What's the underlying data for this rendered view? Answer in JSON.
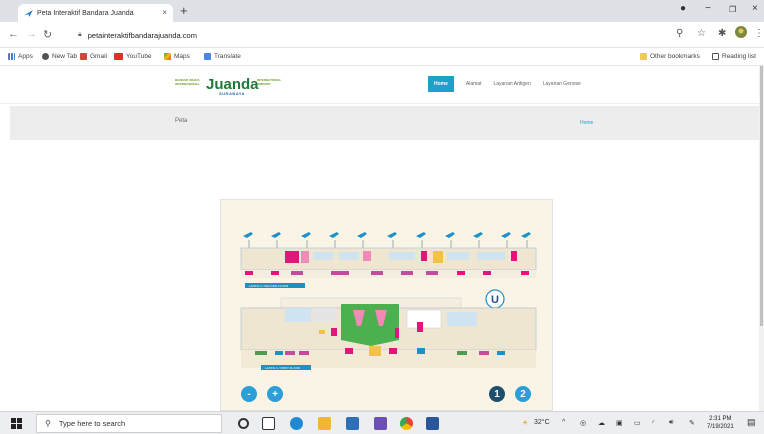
{
  "browser": {
    "tab_title": "Peta Interaktif Bandara Juanda",
    "tab_close": "×",
    "new_tab": "+",
    "minimize": "−",
    "restore": "❐",
    "close": "×",
    "url": "petainteraktifbandarajuanda.com"
  },
  "bookmarks": {
    "items": [
      "Apps",
      "New Tab",
      "Gmail",
      "YouTube",
      "Maps",
      "Translate"
    ],
    "other": "Other bookmarks",
    "reading_list": "Reading list"
  },
  "site": {
    "logo_left_lines": [
      "BANDAR UDARA",
      "INTERNASIONAL"
    ],
    "logo_name": "Juanda",
    "logo_right_lines": [
      "INTERNATIONAL",
      "AIRPORT"
    ],
    "logo_city": "SURABAYA",
    "nav": [
      "Home",
      "Alamat",
      "Layanan Antigen",
      "Layanan Genose"
    ],
    "page_title": "Peta",
    "breadcrumb": "Home"
  },
  "map": {
    "second_floor_label": "LANTAI 2 / SECOND FLOOR",
    "first_floor_label": "LANTAI 1 / FIRST FLOOR",
    "badge_letter": "U",
    "zoom_out": "-",
    "zoom_in": "+",
    "floor_1": "1",
    "floor_2": "2"
  },
  "taskbar": {
    "search_placeholder": "Type here to search",
    "temperature": "32°C",
    "time": "2:31 PM",
    "date": "7/19/2021"
  },
  "colors": {
    "accent": "#1da1c9",
    "brand_green": "#1e7a3a",
    "zoom_button": "#2d9fd8",
    "floor_active": "#1d4f6e",
    "map_bg": "#faf4e6"
  }
}
